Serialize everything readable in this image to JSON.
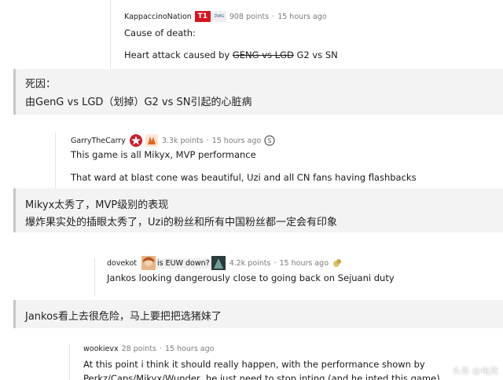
{
  "comment1": {
    "username": "KappaccinoNation",
    "points": "908 points",
    "time": "15 hours ago",
    "flair_t1": "T1",
    "flair_dwg": "DWG",
    "line1": "Cause of death:",
    "line2_prefix": "Heart attack caused by ",
    "line2_strike": "GENG vs LGD",
    "line2_suffix": " G2 vs SN"
  },
  "trans1": {
    "line1": "死因：",
    "line2": "由GenG vs LGD（划掉）G2 vs SN引起的心脏病"
  },
  "comment2": {
    "username": "GarryTheCarry",
    "points": "3.3k points",
    "time": "15 hours ago",
    "line1": "This game is all Mikyx, MVP performance",
    "line2": "That ward at blast cone was beautiful, Uzi and all CN fans having flashbacks"
  },
  "trans2": {
    "line1": "Mikyx太秀了，MVP级别的表现",
    "line2": "爆炸果实处的插眼太秀了，Uzi的粉丝和所有中国粉丝都一定会有印象"
  },
  "comment3": {
    "username": "dovekot",
    "flair_text": "is EUW down?",
    "points": "4.2k points",
    "time": "15 hours ago",
    "line1": "Jankos looking dangerously close to going back on Sejuani duty"
  },
  "trans3": {
    "line1": "Jankos看上去很危险，马上要把把选猪妹了"
  },
  "comment4": {
    "username": "wookievx",
    "points": "28 points",
    "time": "15 hours ago",
    "line1": "At this point i think it should really happen, with the performance shown by",
    "line2": "Perkz/Caps/Mikyx/Wunder, he just need to stop inting (and he inted this game)"
  },
  "watermark": "头条 @电竞"
}
